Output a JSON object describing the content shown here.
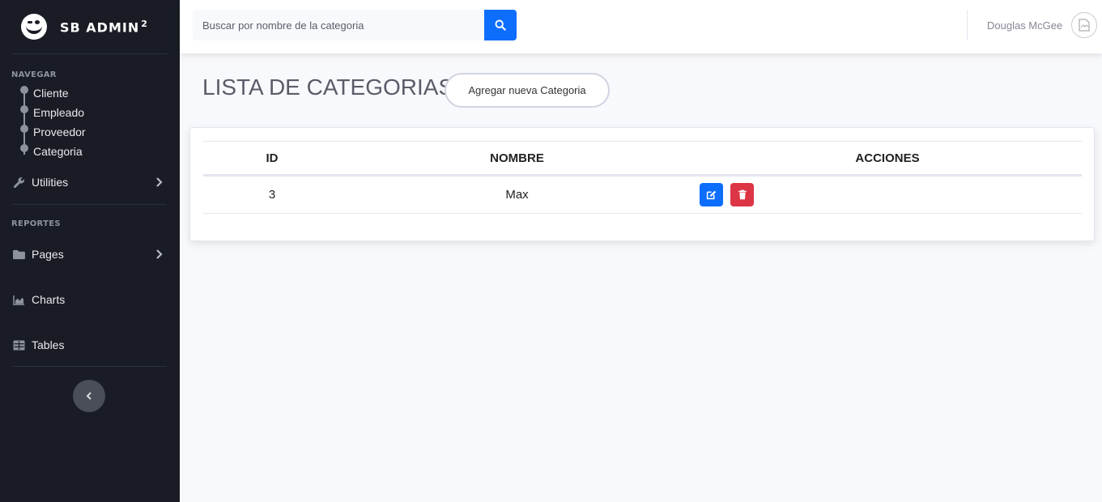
{
  "brand": {
    "name": "SB ADMIN",
    "sup": "2"
  },
  "sidebar": {
    "heading_navegar": "NAVEGAR",
    "tree_items": [
      {
        "label": "Cliente"
      },
      {
        "label": "Empleado"
      },
      {
        "label": "Proveedor"
      },
      {
        "label": "Categoria"
      }
    ],
    "utilities": "Utilities",
    "heading_reportes": "REPORTES",
    "pages": "Pages",
    "charts": "Charts",
    "tables": "Tables"
  },
  "topbar": {
    "search_placeholder": "Buscar por nombre de la categoria",
    "user_name": "Douglas McGee"
  },
  "main": {
    "title": "LISTA DE CATEGORIAS",
    "add_button": "Agregar nueva Categoria",
    "table": {
      "headers": [
        "ID",
        "NOMBRE",
        "ACCIONES"
      ],
      "rows": [
        {
          "id": "3",
          "nombre": "Max"
        }
      ]
    }
  },
  "colors": {
    "sidebar_bg": "#191c24",
    "primary": "#0d6efd",
    "danger": "#dc3545"
  }
}
